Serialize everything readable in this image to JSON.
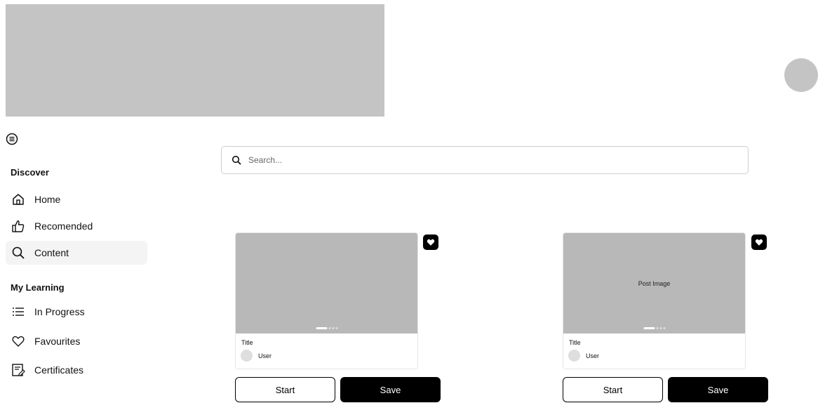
{
  "sidebar": {
    "discover_title": "Discover",
    "discover_items": [
      {
        "label": "Home",
        "icon": "home-icon"
      },
      {
        "label": "Recomended",
        "icon": "thumbs-up-icon"
      },
      {
        "label": "Content",
        "icon": "search-icon",
        "active": true
      }
    ],
    "learning_title": "My Learning",
    "learning_items": [
      {
        "label": "In Progress",
        "icon": "list-icon"
      },
      {
        "label": "Favourites",
        "icon": "heart-icon"
      },
      {
        "label": "Certificates",
        "icon": "certificate-icon"
      }
    ]
  },
  "search": {
    "placeholder": "Search..."
  },
  "cards": [
    {
      "image_text": "",
      "title": "Title",
      "user": "User",
      "start_label": "Start",
      "save_label": "Save"
    },
    {
      "image_text": "Post Image",
      "title": "Title",
      "user": "User",
      "start_label": "Start",
      "save_label": "Save"
    }
  ],
  "colors": {
    "placeholder_gray": "#c4c4c4",
    "primary": "#000000"
  }
}
